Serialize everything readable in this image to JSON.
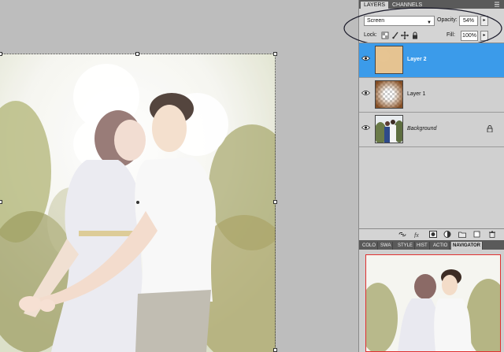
{
  "layers_panel": {
    "tabs": [
      {
        "label": "LAYERS",
        "active": true
      },
      {
        "label": "CHANNELS",
        "active": false
      }
    ],
    "blend_mode": "Screen",
    "opacity_label": "Opacity:",
    "opacity_value": "54%",
    "lock_label": "Lock:",
    "fill_label": "Fill:",
    "fill_value": "100%",
    "layers": [
      {
        "name": "Layer 2",
        "selected": true,
        "visible": true,
        "locked": false
      },
      {
        "name": "Layer 1",
        "selected": false,
        "visible": true,
        "locked": false
      },
      {
        "name": "Background",
        "selected": false,
        "visible": true,
        "locked": true
      }
    ],
    "footer_icons": [
      "link-icon",
      "fx-icon",
      "mask-icon",
      "adjustment-icon",
      "group-folder-icon",
      "new-layer-icon",
      "trash-icon"
    ]
  },
  "navigator_panel": {
    "tabs": [
      {
        "label": "COLO",
        "active": false
      },
      {
        "label": "SWA",
        "active": false
      },
      {
        "label": "STYLE",
        "active": false
      },
      {
        "label": "HIST",
        "active": false
      },
      {
        "label": "ACTIO",
        "active": false
      },
      {
        "label": "NAVIGATOR",
        "active": true
      }
    ]
  },
  "colors": {
    "workspace_bg": "#bdbdbd",
    "selected_layer": "#3b9bea",
    "panel_bg": "#d4d4d4",
    "navigator_view_box": "#e03030"
  }
}
